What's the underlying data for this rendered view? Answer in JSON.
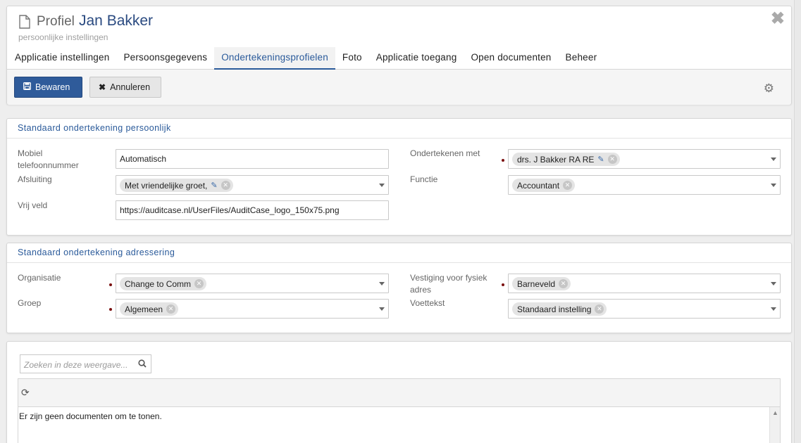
{
  "header": {
    "title_prefix": "Profiel",
    "title_name": "Jan Bakker",
    "subtitle": "persoonlijke instellingen",
    "close_glyph": "✖",
    "tabs": [
      {
        "label": "Applicatie instellingen",
        "active": false
      },
      {
        "label": "Persoonsgegevens",
        "active": false
      },
      {
        "label": "Ondertekeningsprofielen",
        "active": true
      },
      {
        "label": "Foto",
        "active": false
      },
      {
        "label": "Applicatie toegang",
        "active": false
      },
      {
        "label": "Open documenten",
        "active": false
      },
      {
        "label": "Beheer",
        "active": false
      }
    ]
  },
  "toolbar": {
    "save_label": "Bewaren",
    "cancel_label": "Annuleren",
    "settings_icon": "gear-icon"
  },
  "personal": {
    "title": "Standaard ondertekening persoonlijk",
    "mobile_label": "Mobiel telefoonnummer",
    "mobile_value": "Automatisch",
    "closing_label": "Afsluiting",
    "closing_value": "Met vriendelijke groet,",
    "free_label": "Vrij veld",
    "free_value": "https://auditcase.nl/UserFiles/AuditCase_logo_150x75.png",
    "signwith_label": "Ondertekenen met",
    "signwith_value": "drs. J Bakker RA RE",
    "function_label": "Functie",
    "function_value": "Accountant"
  },
  "addressing": {
    "title": "Standaard ondertekening adressering",
    "org_label": "Organisatie",
    "org_value": "Change to Comm",
    "group_label": "Groep",
    "group_value": "Algemeen",
    "location_label": "Vestiging voor fysiek adres",
    "location_value": "Barneveld",
    "footer_label": "Voettekst",
    "footer_value": "Standaard instelling"
  },
  "documents": {
    "search_placeholder": "Zoeken in deze weergave...",
    "empty_text": "Er zijn geen documenten om te tonen."
  },
  "colors": {
    "accent": "#2a5a9a",
    "primary_button": "#2f5b9a",
    "required_dot": "#7a1010"
  }
}
